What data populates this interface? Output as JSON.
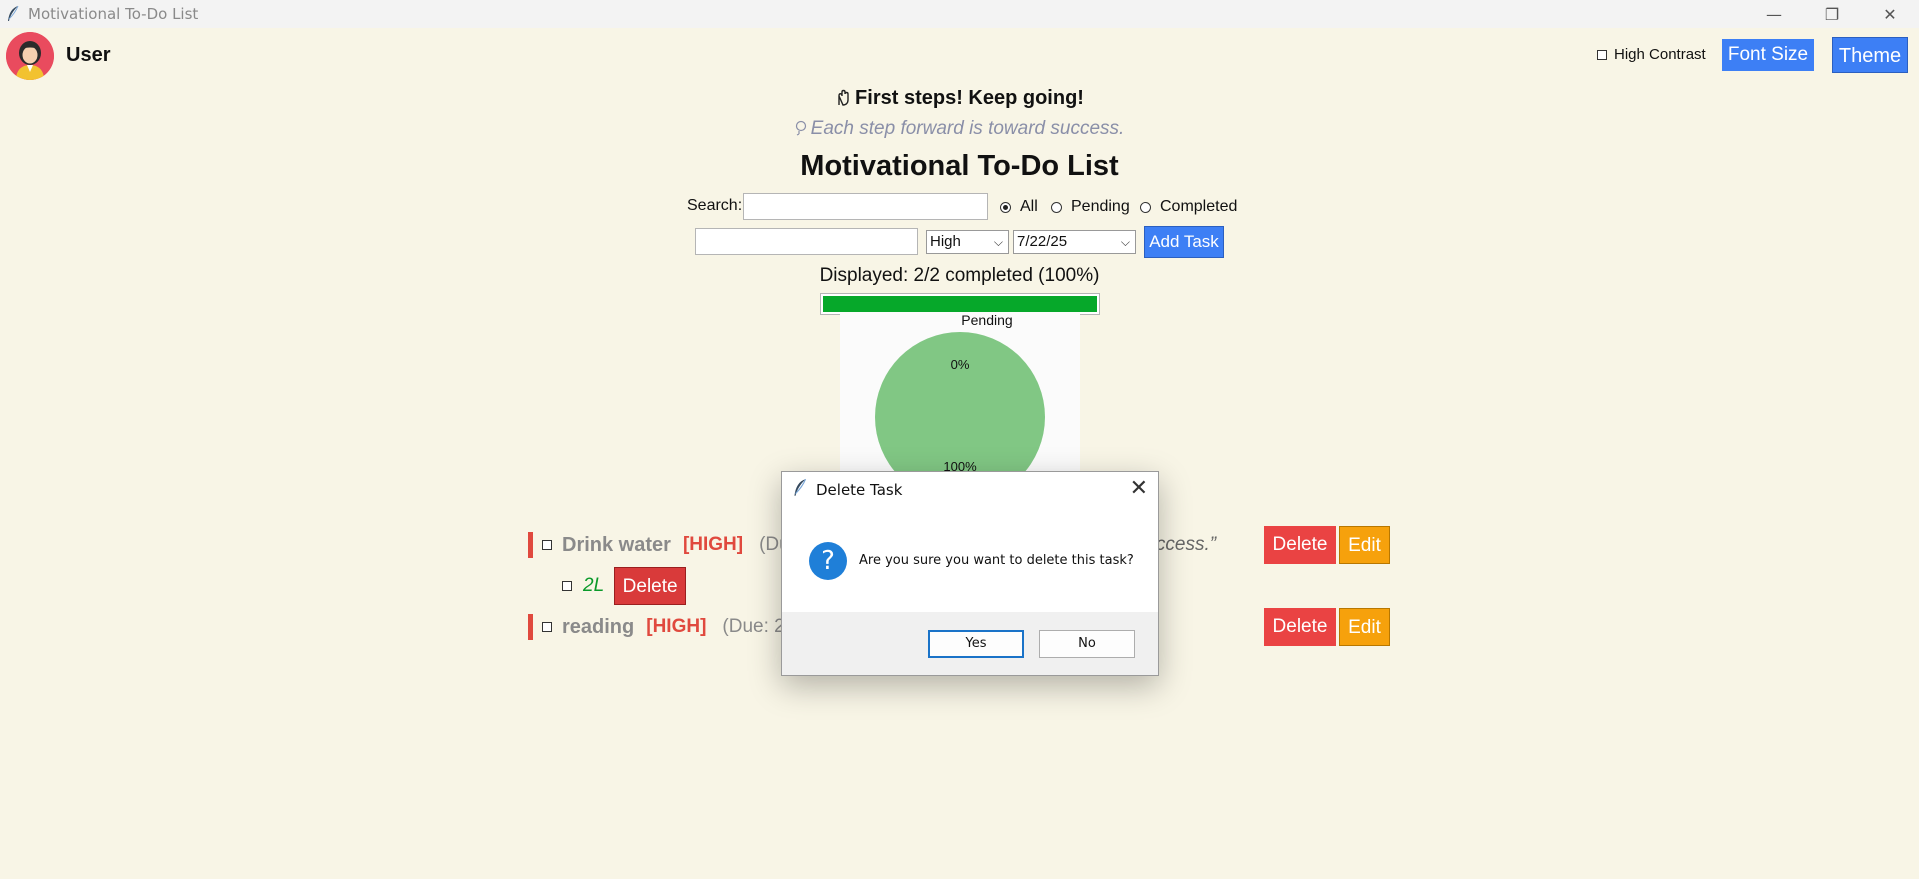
{
  "window": {
    "title": "Motivational To-Do List",
    "controls": [
      "—",
      "❐",
      "✕"
    ]
  },
  "user": {
    "name": "User"
  },
  "header": {
    "high_contrast_label": "High Contrast",
    "font_size_label": "Font Size",
    "theme_label": "Theme"
  },
  "motivation": {
    "headline": "First steps! Keep going!",
    "tip": "Each step forward is toward success."
  },
  "main": {
    "title": "Motivational To-Do List"
  },
  "filter": {
    "search_label": "Search:",
    "search_value": "",
    "options": [
      "All",
      "Pending",
      "Completed"
    ],
    "selected": "All"
  },
  "new_task": {
    "value": "",
    "priority": "High",
    "due_date": "7/22/25",
    "add_label": "Add Task"
  },
  "stats": {
    "displayed_text": "Displayed: 2/2 completed (100%)",
    "progress": 1.0
  },
  "chart_data": {
    "type": "pie",
    "labels": [
      "Pending",
      "Completed"
    ],
    "values": [
      0,
      100
    ],
    "data_labels": [
      "0%",
      "100%"
    ],
    "visible_label": "Pending",
    "colors": [
      "#81c784",
      "#81c784"
    ]
  },
  "tasks": [
    {
      "name": "Drink water",
      "priority": "[HIGH]",
      "due": "(Due",
      "quote": "d success.”",
      "delete_label": "Delete",
      "edit_label": "Edit",
      "subtasks": [
        {
          "text": "2L",
          "delete_label": "Delete"
        }
      ]
    },
    {
      "name": "reading",
      "priority": "[HIGH]",
      "due": "(Due: 20",
      "delete_label": "Delete",
      "edit_label": "Edit"
    }
  ],
  "dialog": {
    "title": "Delete Task",
    "message": "Are you sure you want to delete this task?",
    "yes_label": "Yes",
    "no_label": "No",
    "close_glyph": "✕",
    "question_glyph": "?"
  },
  "colors": {
    "background": "#f8f5e6",
    "accent_blue": "#3d7ff5",
    "progress_green": "#06a82a",
    "delete_red": "#ea4343",
    "edit_orange": "#f6a10c",
    "priority_red": "#e0493e"
  }
}
